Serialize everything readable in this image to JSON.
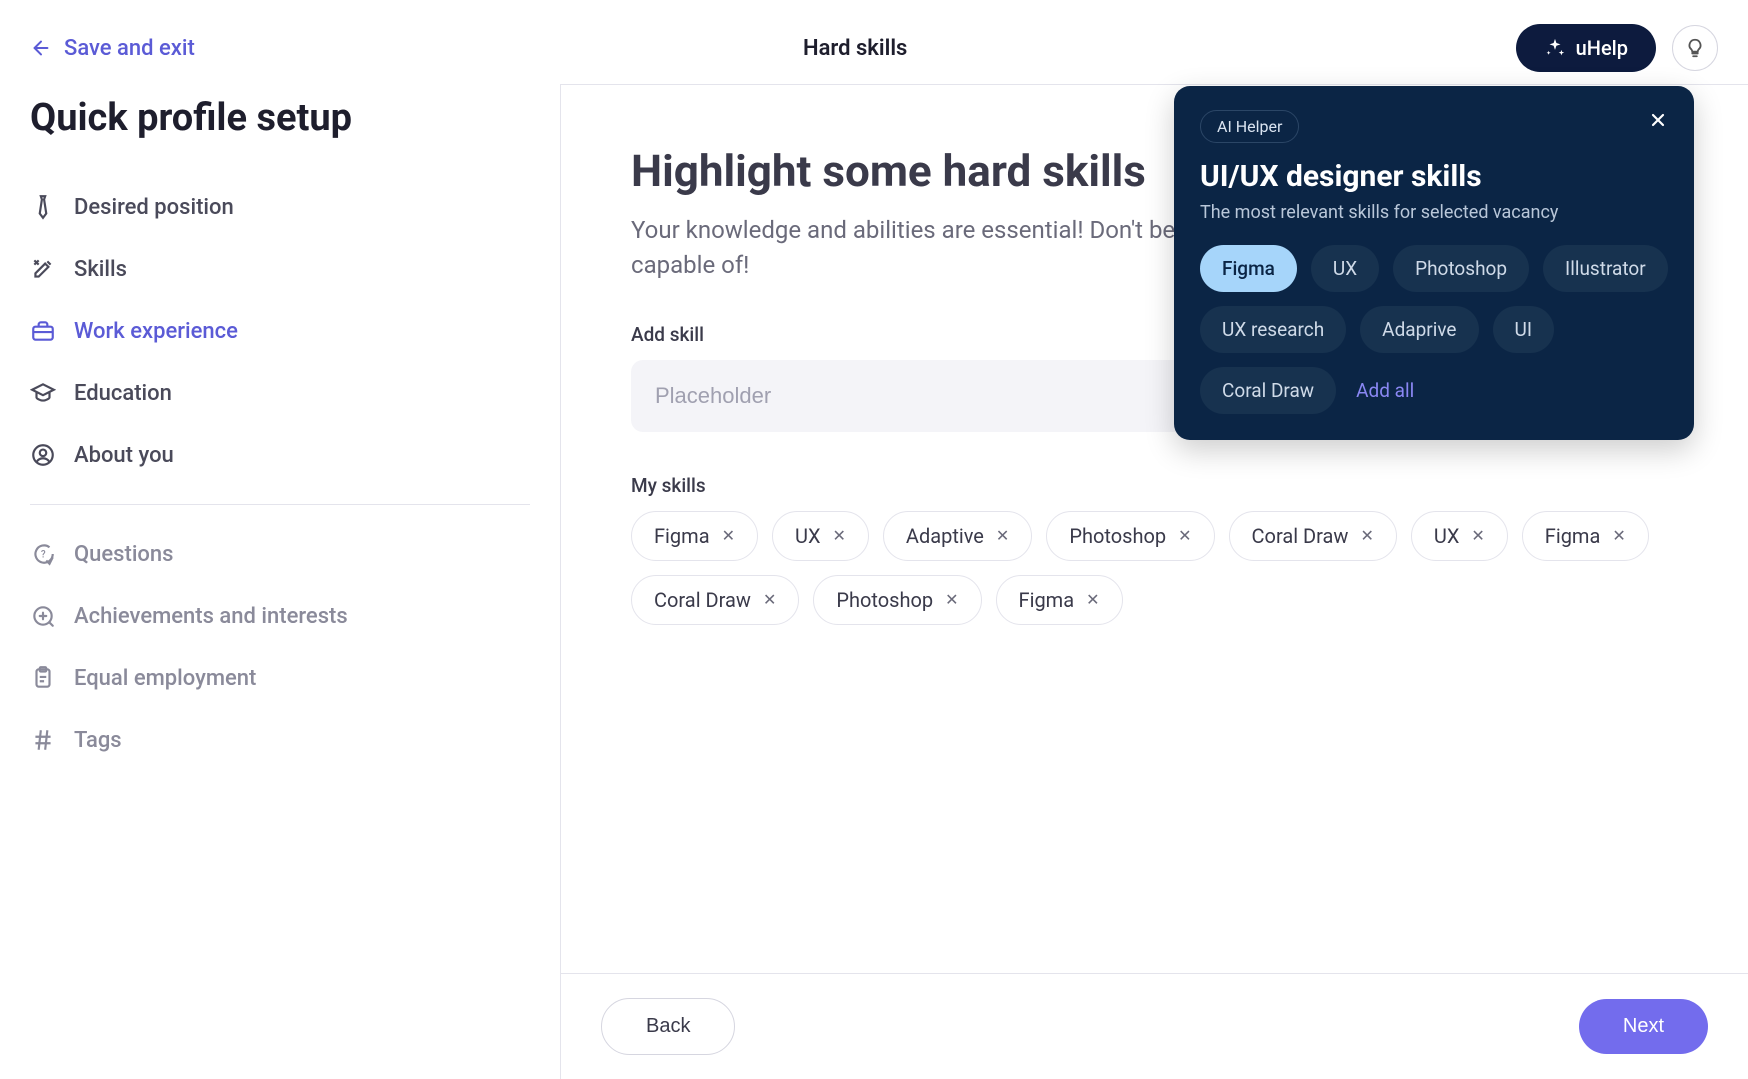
{
  "header": {
    "save_exit": "Save and exit",
    "title": "Hard skills",
    "uhelp": "uHelp"
  },
  "sidebar": {
    "title": "Quick profile setup",
    "items": [
      {
        "label": "Desired position"
      },
      {
        "label": "Skills"
      },
      {
        "label": "Work experience"
      },
      {
        "label": "Education"
      },
      {
        "label": "About you"
      }
    ],
    "secondary": [
      {
        "label": "Questions"
      },
      {
        "label": "Achievements and interests"
      },
      {
        "label": "Equal employment"
      },
      {
        "label": "Tags"
      }
    ]
  },
  "main": {
    "heading": "Highlight some hard skills",
    "subtext": "Your knowledge and abilities are essential! Don't be shy and show what you're capable of!",
    "add_skill_label": "Add skill",
    "placeholder": "Placeholder",
    "my_skills_label": "My skills",
    "skills": [
      "Figma",
      "UX",
      "Adaptive",
      "Photoshop",
      "Coral Draw",
      "UX",
      "Figma",
      "Coral Draw",
      "Photoshop",
      "Figma"
    ]
  },
  "popover": {
    "badge": "AI Helper",
    "title": "UI/UX designer skills",
    "subtitle": "The most relevant skills for selected vacancy",
    "suggestions": [
      "Figma",
      "UX",
      "Photoshop",
      "Illustrator",
      "UX research",
      "Adaprive",
      "UI",
      "Coral Draw"
    ],
    "active_index": 0,
    "add_all": "Add all"
  },
  "footer": {
    "back": "Back",
    "next": "Next"
  }
}
